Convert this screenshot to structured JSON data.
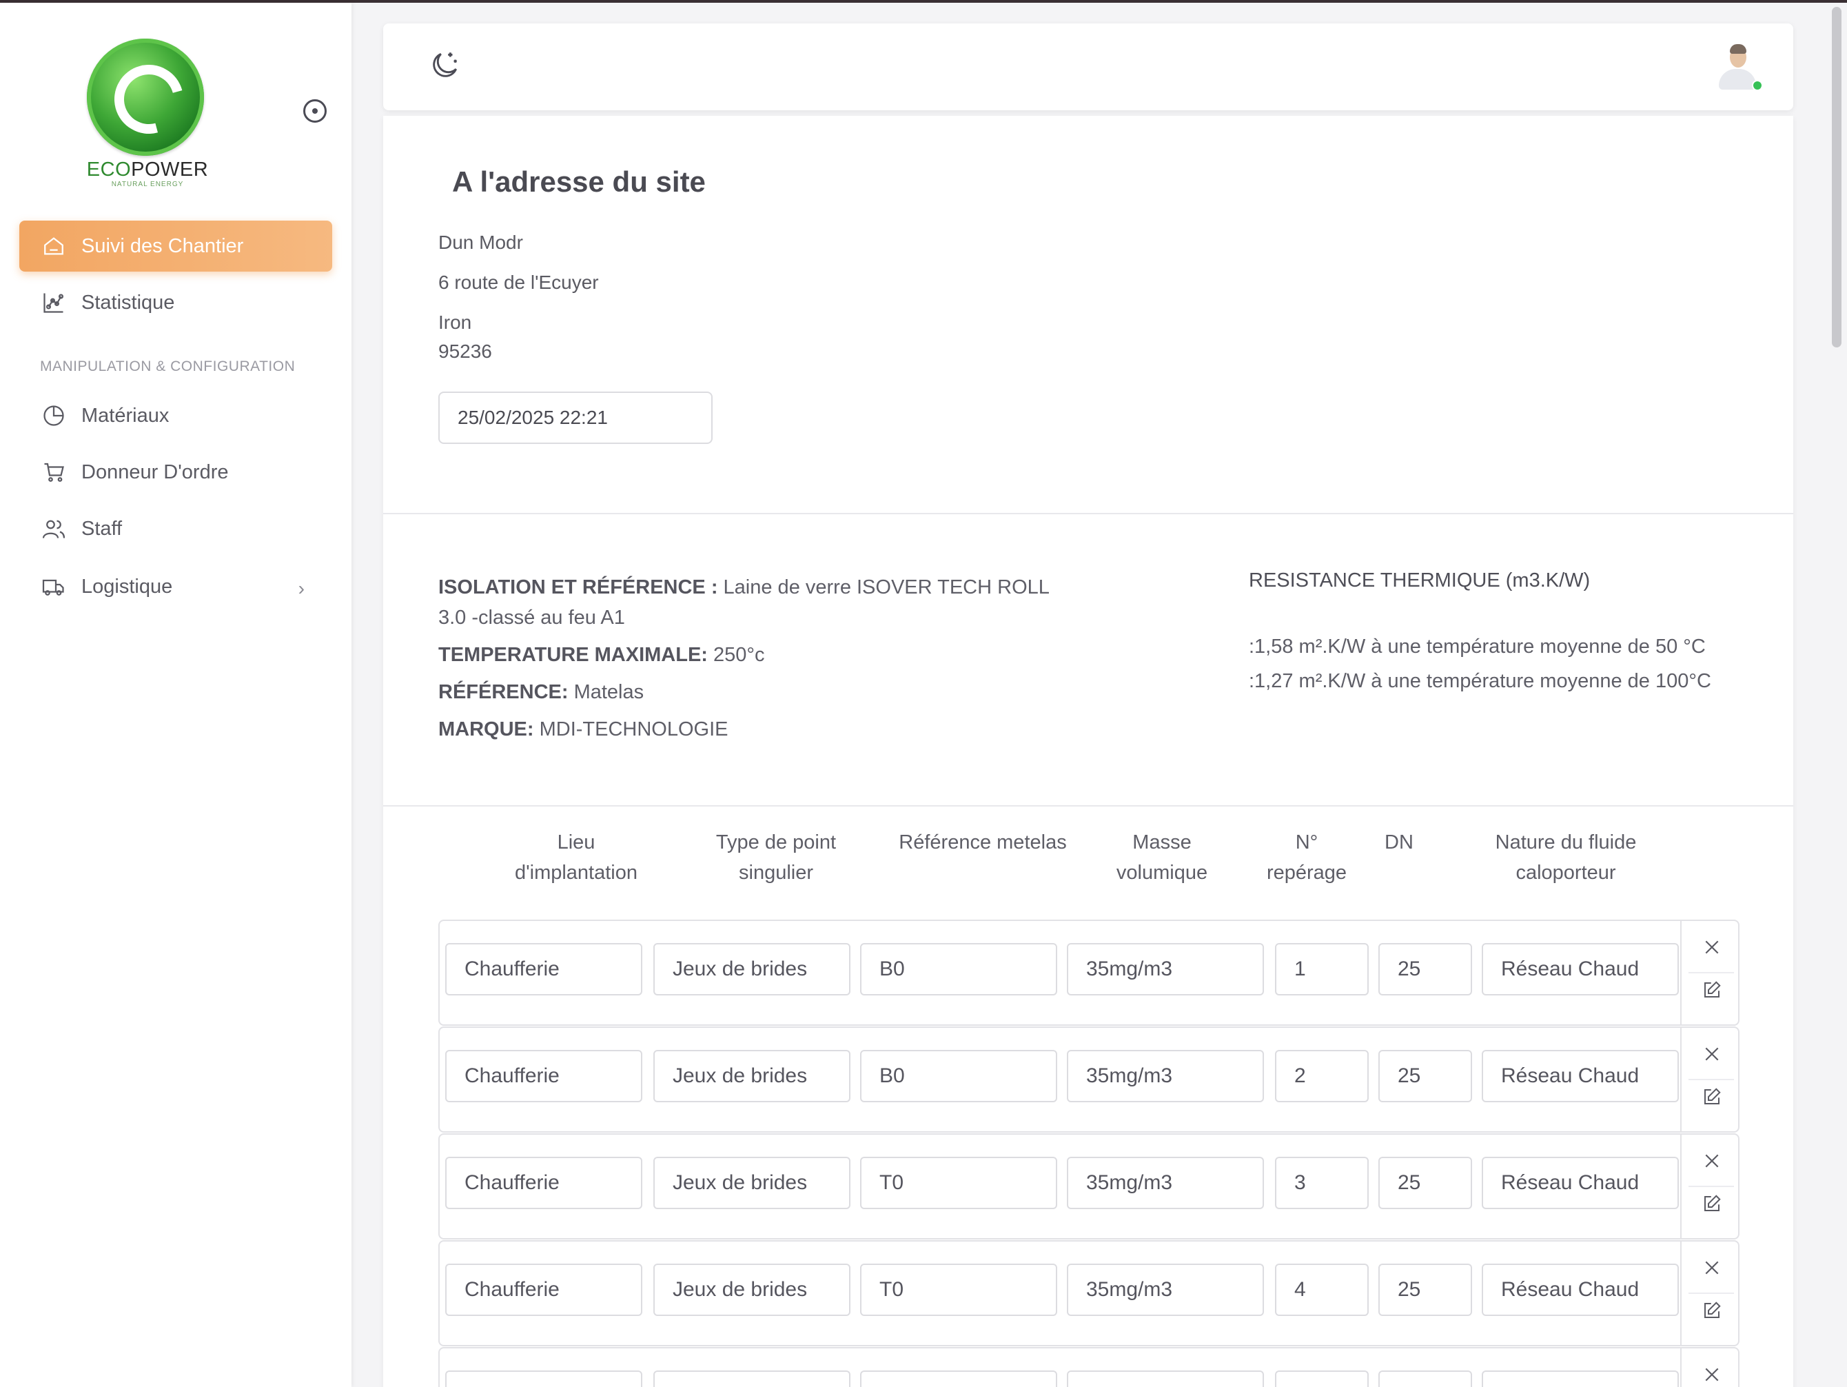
{
  "brand": {
    "name_part1": "ECO",
    "name_part2": "POWER",
    "tagline": "NATURAL ENERGY"
  },
  "sidebar": {
    "items": [
      {
        "label": "Suivi des Chantier",
        "icon": "home-icon",
        "active": true
      },
      {
        "label": "Statistique",
        "icon": "chart-icon"
      }
    ],
    "section_label": "MANIPULATION & CONFIGURATION",
    "config_items": [
      {
        "label": "Matériaux",
        "icon": "pie-chart-icon"
      },
      {
        "label": "Donneur D'ordre",
        "icon": "cart-icon"
      },
      {
        "label": "Staff",
        "icon": "users-icon"
      },
      {
        "label": "Logistique",
        "icon": "truck-icon"
      }
    ]
  },
  "site": {
    "title": "A l'adresse du site",
    "name": "Dun Modr",
    "street": "6 route de l'Ecuyer",
    "city": "Iron",
    "postcode": "95236",
    "datetime": "25/02/2025 22:21"
  },
  "insulation": {
    "isolation_label": "ISOLATION ET RÉFÉRENCE :",
    "isolation_value_line1": "Laine de verre ISOVER TECH ROLL",
    "isolation_value_line2": "3.0 -classé au feu A1",
    "temp_label": "TEMPERATURE MAXIMALE:",
    "temp_value": "250°c",
    "ref_label": "RÉFÉRENCE:",
    "ref_value": "Matelas",
    "brand_label": "MARQUE:",
    "brand_value": "MDI-TECHNOLOGIE",
    "resistance_title": "RESISTANCE THERMIQUE (m3.K/W)",
    "resistance_line1": ":1,58 m².K/W à une température moyenne de 50 °C",
    "resistance_line2": ":1,27 m².K/W à une température moyenne de 100°C"
  },
  "table": {
    "headers": [
      {
        "line1": "Lieu",
        "line2": "d'implantation"
      },
      {
        "line1": "Type de point",
        "line2": "singulier"
      },
      {
        "line1": "Référence metelas",
        "line2": ""
      },
      {
        "line1": "Masse",
        "line2": "volumique"
      },
      {
        "line1": "N°",
        "line2": "repérage"
      },
      {
        "line1": "DN",
        "line2": ""
      },
      {
        "line1": "Nature du fluide",
        "line2": "caloporteur"
      }
    ],
    "rows": [
      {
        "lieu": "Chaufferie",
        "type": "Jeux de brides",
        "ref": "B0",
        "masse": "35mg/m3",
        "num": "1",
        "dn": "25",
        "fluide": "Réseau Chaud"
      },
      {
        "lieu": "Chaufferie",
        "type": "Jeux de brides",
        "ref": "B0",
        "masse": "35mg/m3",
        "num": "2",
        "dn": "25",
        "fluide": "Réseau Chaud"
      },
      {
        "lieu": "Chaufferie",
        "type": "Jeux de brides",
        "ref": "T0",
        "masse": "35mg/m3",
        "num": "3",
        "dn": "25",
        "fluide": "Réseau Chaud"
      },
      {
        "lieu": "Chaufferie",
        "type": "Jeux de brides",
        "ref": "T0",
        "masse": "35mg/m3",
        "num": "4",
        "dn": "25",
        "fluide": "Réseau Chaud"
      }
    ]
  },
  "colors": {
    "accent": "#f2a662",
    "status_online": "#36c156"
  }
}
